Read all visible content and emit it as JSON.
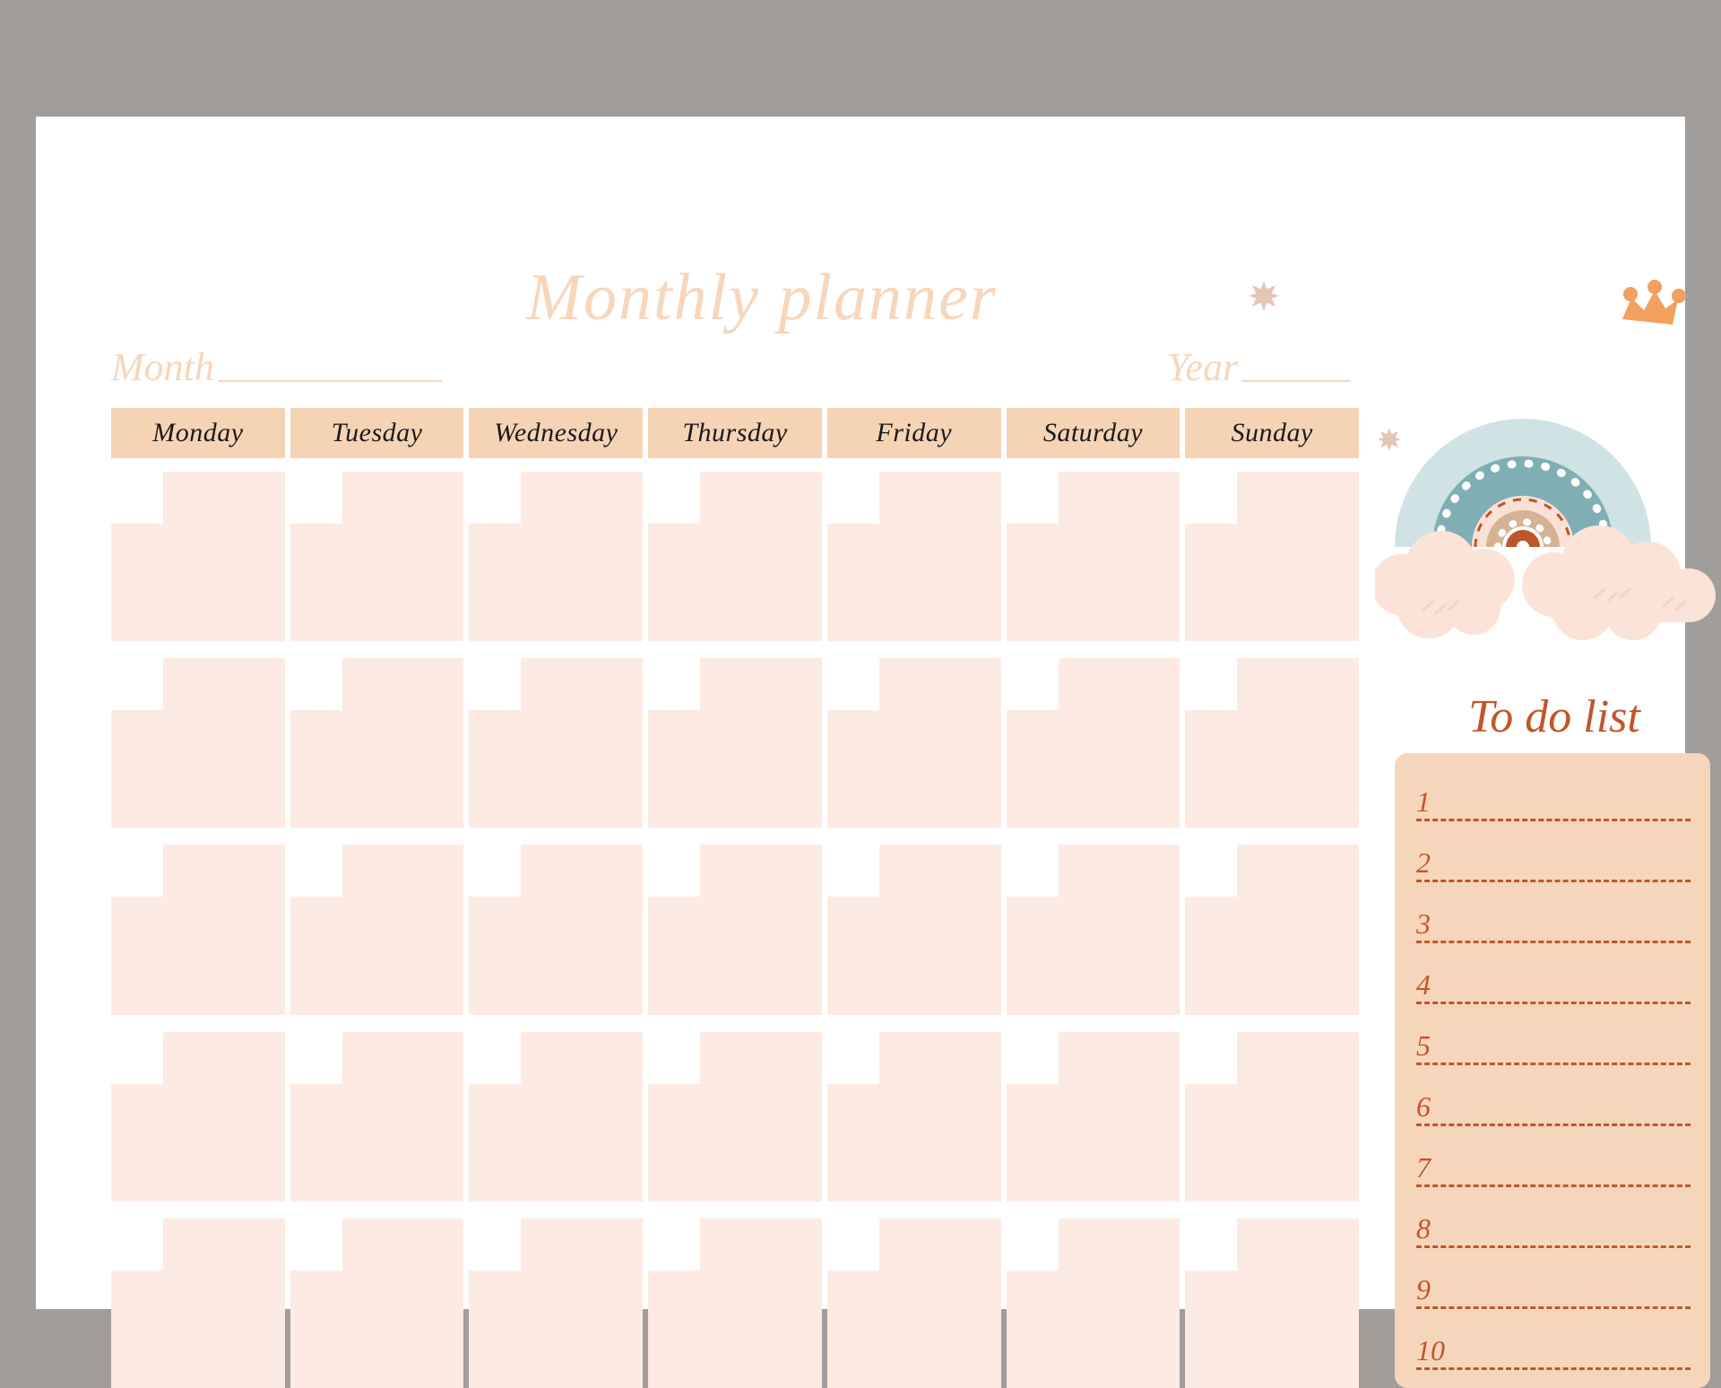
{
  "page": {
    "background_color": "#a09d9b",
    "card_color": "#ffffff"
  },
  "header": {
    "title": "Monthly planner",
    "title_color": "#f7d6bb",
    "month_label": "Month",
    "year_label": "Year",
    "month_value": "",
    "year_value": ""
  },
  "calendar": {
    "weekdays": [
      "Monday",
      "Tuesday",
      "Wednesday",
      "Thursday",
      "Friday",
      "Saturday",
      "Sunday"
    ],
    "header_bg_color": "#f5d3b5",
    "header_text_color": "#1a1a1a",
    "cell_color": "#fdeae2",
    "notch_color": "#ffffff",
    "rows": 5,
    "columns": 7,
    "cells": [
      [
        "",
        "",
        "",
        "",
        "",
        "",
        ""
      ],
      [
        "",
        "",
        "",
        "",
        "",
        "",
        ""
      ],
      [
        "",
        "",
        "",
        "",
        "",
        "",
        ""
      ],
      [
        "",
        "",
        "",
        "",
        "",
        "",
        ""
      ],
      [
        "",
        "",
        "",
        "",
        "",
        "",
        ""
      ]
    ]
  },
  "todo": {
    "title": "To do list",
    "title_color": "#c1562a",
    "panel_color": "#f6d6bb",
    "line_color": "#c1562a",
    "items": [
      {
        "number": "1",
        "text": ""
      },
      {
        "number": "2",
        "text": ""
      },
      {
        "number": "3",
        "text": ""
      },
      {
        "number": "4",
        "text": ""
      },
      {
        "number": "5",
        "text": ""
      },
      {
        "number": "6",
        "text": ""
      },
      {
        "number": "7",
        "text": ""
      },
      {
        "number": "8",
        "text": ""
      },
      {
        "number": "9",
        "text": ""
      },
      {
        "number": "10",
        "text": ""
      }
    ]
  },
  "decorations": {
    "rainbow": {
      "name": "rainbow-with-clouds",
      "arc_colors": [
        "#cfe3e5",
        "#7fafb5",
        "#fae0d5",
        "#d6b294",
        "#c0542a"
      ],
      "dot_color": "#ffffff",
      "dash_color": "#c0542a",
      "cloud_color": "#fbe3d8",
      "crown_color": "#f2a05e"
    },
    "sparkles": [
      {
        "name": "sparkle-star",
        "color": "#e4c5b6"
      },
      {
        "name": "sparkle-star",
        "color": "#e4c5b6"
      }
    ]
  }
}
